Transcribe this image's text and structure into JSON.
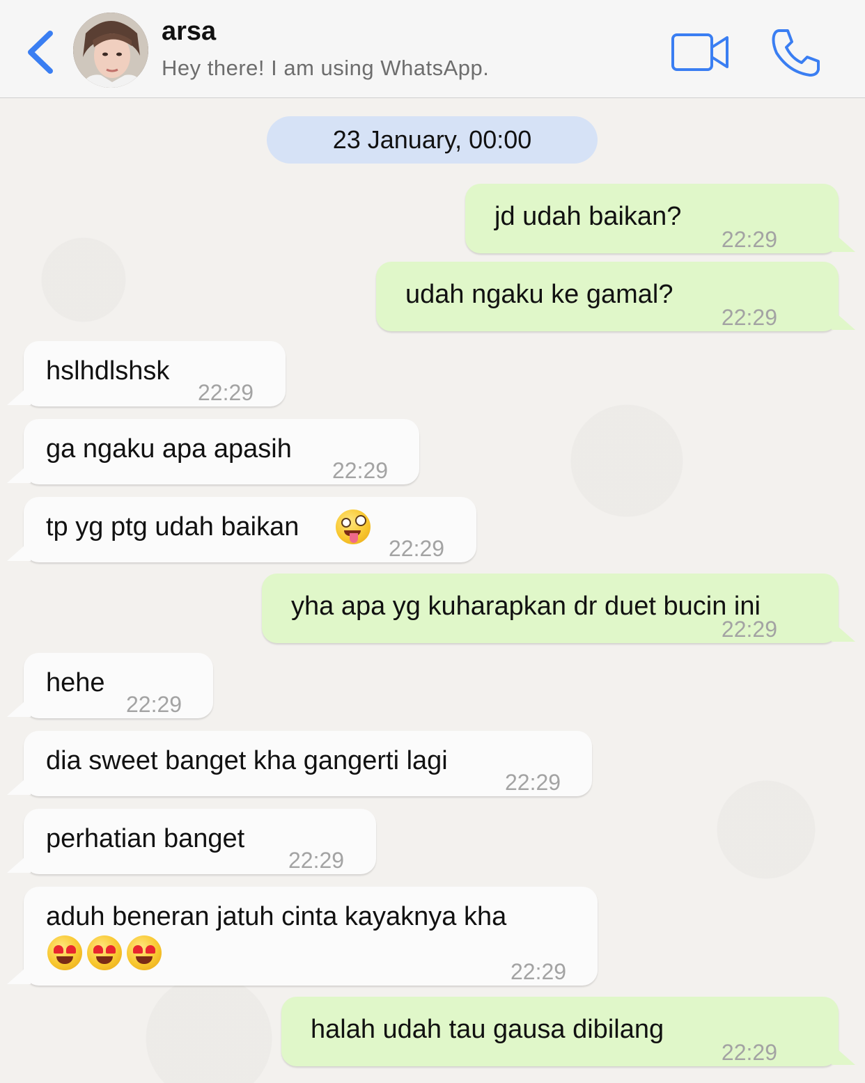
{
  "header": {
    "back_icon": "chevron-left-icon",
    "contact_name": "arsa",
    "contact_status": "Hey there! I am using WhatsApp.",
    "video_icon": "video-camera-icon",
    "call_icon": "phone-icon",
    "accent_color": "#3a7ef2"
  },
  "chat": {
    "date_label": "23 January, 00:00",
    "messages": [
      {
        "direction": "out",
        "text": "jd udah baikan?",
        "time": "22:29"
      },
      {
        "direction": "out",
        "text": "udah ngaku ke gamal?",
        "time": "22:29"
      },
      {
        "direction": "in",
        "text": "hslhdlshsk",
        "time": "22:29"
      },
      {
        "direction": "in",
        "text": "ga ngaku apa apasih",
        "time": "22:29"
      },
      {
        "direction": "in",
        "text": "tp yg ptg udah baikan",
        "emoji": "zany-face",
        "time": "22:29"
      },
      {
        "direction": "out",
        "text": "yha apa yg kuharapkan dr duet bucin ini",
        "time": "22:29"
      },
      {
        "direction": "in",
        "text": "hehe",
        "time": "22:29"
      },
      {
        "direction": "in",
        "text": "dia sweet banget kha gangerti lagi",
        "time": "22:29"
      },
      {
        "direction": "in",
        "text": "perhatian banget",
        "time": "22:29"
      },
      {
        "direction": "in",
        "text": "aduh beneran jatuh cinta kayaknya kha",
        "emoji": "heart-eyes-face x3",
        "time": "22:29"
      },
      {
        "direction": "out",
        "text": "halah udah tau gausa dibilang",
        "time": "22:29"
      }
    ],
    "colors": {
      "incoming": "#fbfbfb",
      "outgoing": "#e0f7c9",
      "date_pill": "#d6e2f6"
    }
  }
}
